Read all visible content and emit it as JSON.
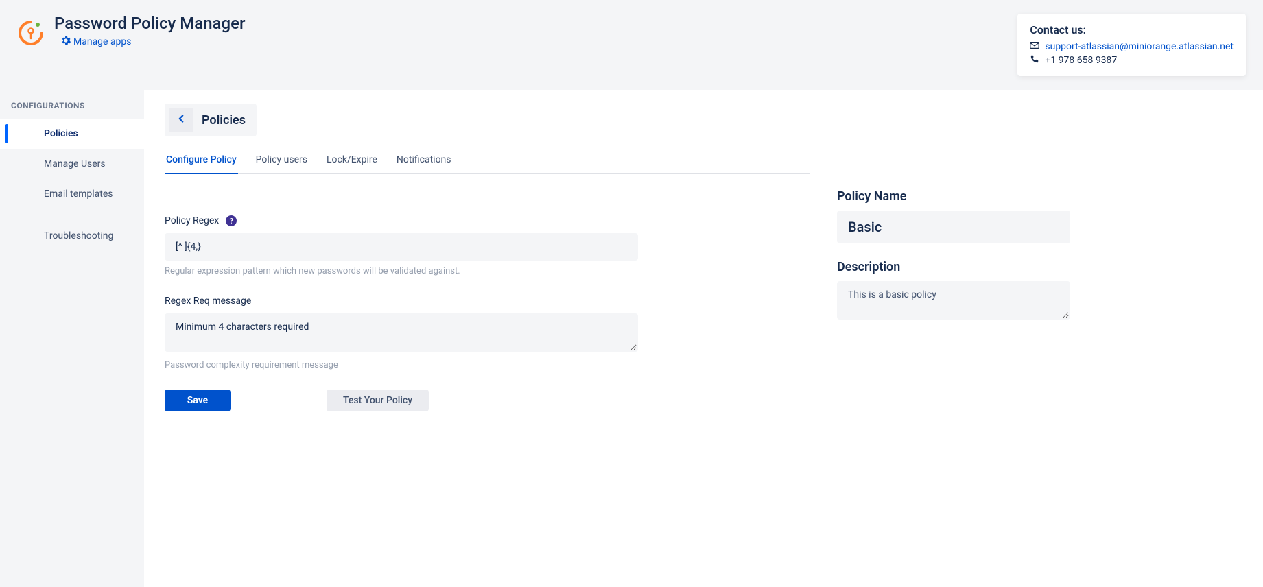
{
  "header": {
    "title": "Password Policy Manager",
    "manage_apps_label": "Manage apps"
  },
  "contact": {
    "title": "Contact us:",
    "email": "support-atlassian@miniorange.atlassian.net",
    "phone": "+1 978 658 9387"
  },
  "sidebar": {
    "section": "CONFIGURATIONS",
    "items": [
      {
        "label": "Policies"
      },
      {
        "label": "Manage Users"
      },
      {
        "label": "Email templates"
      }
    ],
    "troubleshooting": "Troubleshooting"
  },
  "page": {
    "heading": "Policies"
  },
  "tabs": [
    {
      "label": "Configure Policy"
    },
    {
      "label": "Policy users"
    },
    {
      "label": "Lock/Expire"
    },
    {
      "label": "Notifications"
    }
  ],
  "form": {
    "regex_label": "Policy Regex",
    "regex_value": "[^ ]{4,}",
    "regex_hint": "Regular expression pattern which new passwords will be validated against.",
    "msg_label": "Regex Req message",
    "msg_value": "Minimum 4 characters required",
    "msg_hint": "Password complexity requirement message",
    "save_label": "Save",
    "test_label": "Test Your Policy"
  },
  "side_panel": {
    "name_label": "Policy Name",
    "name_value": "Basic",
    "desc_label": "Description",
    "desc_value": "This is a basic policy"
  }
}
